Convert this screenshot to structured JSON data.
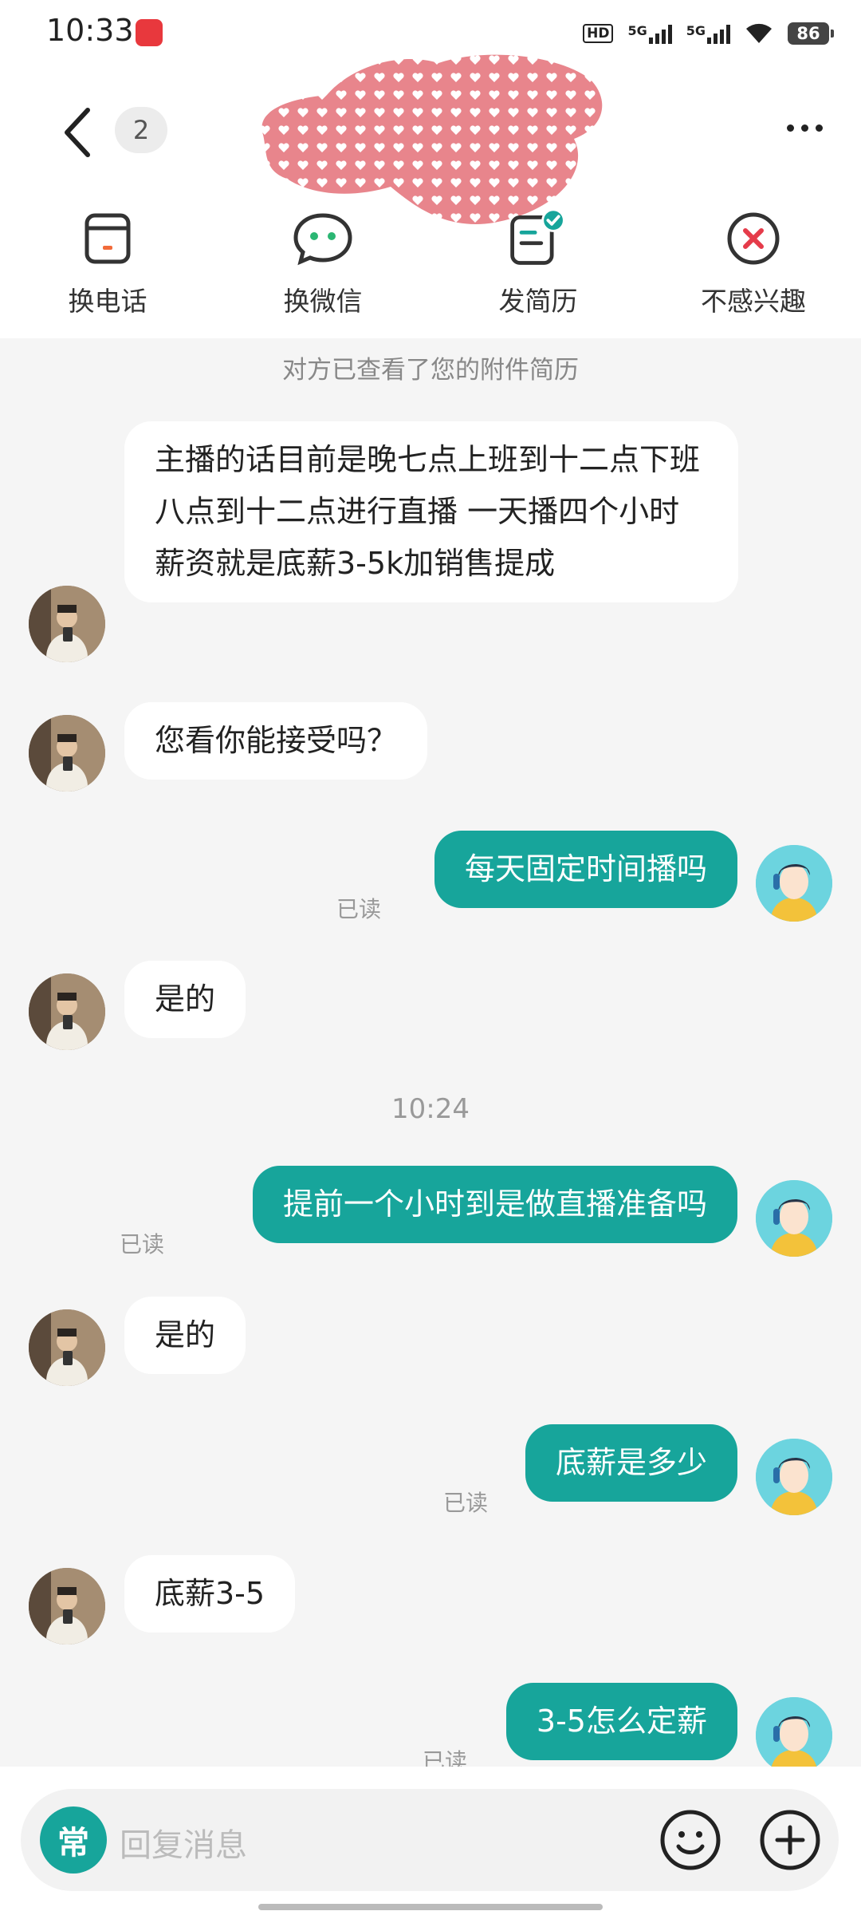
{
  "status_bar": {
    "time": "10:33",
    "net1": "5G",
    "net2": "5G",
    "battery": "86"
  },
  "header": {
    "unread_count": "2"
  },
  "actions": [
    {
      "label": "换电话",
      "icon": "phone-card-icon"
    },
    {
      "label": "换微信",
      "icon": "wechat-icon"
    },
    {
      "label": "发简历",
      "icon": "resume-check-icon"
    },
    {
      "label": "不感兴趣",
      "icon": "not-interested-icon"
    }
  ],
  "chat": {
    "system_note": "对方已查看了您的附件简历",
    "timestamp": "10:24",
    "read_label": "已读",
    "messages": [
      {
        "from": "other",
        "text": "主播的话目前是晚七点上班到十二点下班 八点到十二点进行直播 一天播四个小时 薪资就是底薪3-5k加销售提成"
      },
      {
        "from": "other",
        "text": "您看你能接受吗？"
      },
      {
        "from": "me",
        "text": "每天固定时间播吗"
      },
      {
        "from": "other",
        "text": "是的"
      },
      {
        "from": "me",
        "text": "提前一个小时到是做直播准备吗"
      },
      {
        "from": "other",
        "text": "是的"
      },
      {
        "from": "me",
        "text": "底薪是多少"
      },
      {
        "from": "other",
        "text": "底薪3-5"
      },
      {
        "from": "me",
        "text": "3-5怎么定薪"
      }
    ]
  },
  "input": {
    "quick_label": "常",
    "placeholder": "回复消息"
  },
  "colors": {
    "accent": "#17a59b",
    "bubble_in": "#ffffff",
    "background": "#f5f5f5"
  }
}
